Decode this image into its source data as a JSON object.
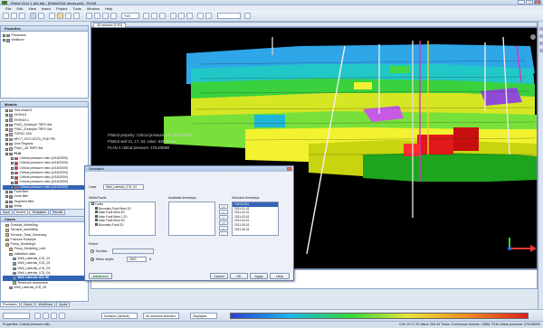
{
  "app": {
    "title": "Petrel 2011.1 (64-bit) - [Petrel2011 demo.pet] - PLMS"
  },
  "menu": [
    "File",
    "Edit",
    "View",
    "Insert",
    "Project",
    "Tools",
    "Window",
    "Help"
  ],
  "toolbar": {
    "zoom_select": "TVD"
  },
  "left_panels": {
    "favorites": {
      "title": "Favorites",
      "items": [
        "Pressures",
        "Wellbore"
      ]
    },
    "models": {
      "title": "Models",
      "items": [
        "Grid head24",
        "SHTe4/4",
        "SHTe4/4 c",
        "PVAC_Example TBPV flat",
        "PVAC_Example TBPV flat",
        "TOPAC-02b",
        "BPCT_RCS DS7A_FDE PM",
        "Grid Regions",
        "PVAC_4A TBPV flat",
        "PLM",
        "Critical pressure ratio (4/18/2009)",
        "Critical pressure ratio (4/18/2009)",
        "Critical pressure ratio (4/18/2009)",
        "Critical pressure ratio (4/18/2009)",
        "Critical pressure ratio (4/18/2009)",
        "Critical pressure ratio (4/18/2009)",
        "Critical pressure ratio (4/18/2009)",
        "Fault filter",
        "Zone filter",
        "Segment filter",
        "Wells",
        "Tops"
      ]
    },
    "tabs": [
      "Input",
      "Models",
      "Templates",
      "Results"
    ],
    "cases": {
      "title": "Cases",
      "items": [
        "Gradual_Modelling",
        "Tornado_sensitivity",
        "Tornado_Total_Summary",
        "Fracture Example",
        "Prosp_Modeling1",
        "Prosp_Modeling_Lat1",
        "Validation data",
        "Well_Laterals_ICD_01",
        "Well_Laterals_ICD_02",
        "Well_Laterals_ICD_03",
        "Well_Laterals_ICD_04",
        "Well Laterals ICD 05",
        "Reservoir drawcheck",
        "Well_Laterals_ICD_05"
      ]
    }
  },
  "viewer": {
    "tab_label": "3D window (TVD)",
    "overlay_lines": [
      "Plotted property: Critical pressure ratio (4/18/2009)",
      "Plotted well 21, 17, 53; value: 545.44 bar",
      "PLAN 4 critical pressure: 475.6/6990"
    ]
  },
  "dialog": {
    "title": "Simulator",
    "case_label": "Case",
    "case_value": "Well_Laterals_ICD_04",
    "wells_label": "Wells/Faults",
    "wells_tree": [
      "Faults",
      "Boundary Fault West 2D",
      "Main Fault West 2D",
      "Main Fault West 1 2D",
      "Main Fault West 2D",
      "Boundary Fault 2D"
    ],
    "available_label": "Available timesteps",
    "selected_label": "Selected timesteps",
    "selected_list": [
      "10/01/2011",
      "2011-01-01",
      "2011-02-01",
      "2011-03-01",
      "2011-04-01",
      "2011-05-01",
      "2011-06-01"
    ],
    "arrow_buttons": [
      ">>",
      ">",
      "<",
      "<<",
      "+",
      "-"
    ],
    "extent_label": "Extent",
    "surface_label": "Surface",
    "mean_depth_label": "Mean depth:",
    "mean_depth_value": "2500",
    "mean_depth_unit": "ft",
    "advanced_button": "Advanced",
    "cancel_button": "Cancel",
    "ok_button": "OK",
    "apply_button": "Apply",
    "help_button": "Help"
  },
  "bottom": {
    "process_tabs": [
      "Processes",
      "Cases",
      "Workflows",
      "Inputs"
    ],
    "bottom_select": "Surfaces (default)",
    "bottom_select2": "No surfaces selected",
    "bottom_mode": "Displayed"
  },
  "status": {
    "left": "Properties: Critical pressure ratio",
    "right": "Cell: 29 17 29   Value: 545.44   Trans: Continuous   Volume: 13684.   PLM critical pressure: 475.6/6990"
  },
  "colors": {
    "accent": "#3264b5",
    "viewer_bg": "#000000"
  }
}
